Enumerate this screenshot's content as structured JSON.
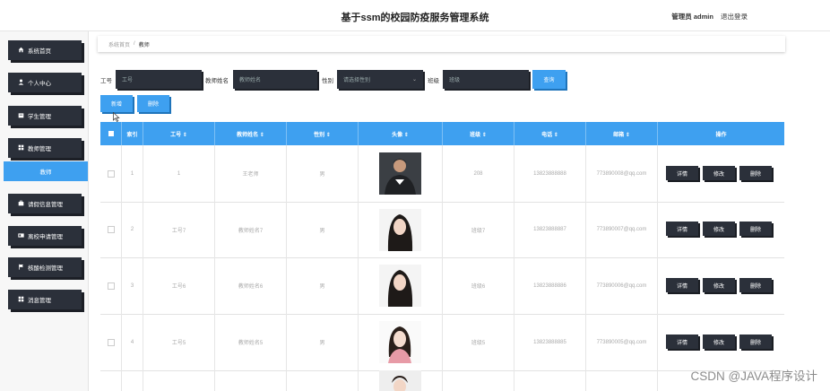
{
  "header": {
    "title": "基于ssm的校园防疫服务管理系统",
    "user_label": "管理员 admin",
    "logout": "退出登录"
  },
  "sidebar": {
    "items": [
      {
        "label": "系统首页",
        "icon": "home-icon"
      },
      {
        "label": "个人中心",
        "icon": "user-icon"
      },
      {
        "label": "学生管理",
        "icon": "folder-icon"
      },
      {
        "label": "教师管理",
        "icon": "grid-icon"
      },
      {
        "label": "教师",
        "icon": "",
        "sub": true
      },
      {
        "label": "请假信息管理",
        "icon": "briefcase-icon"
      },
      {
        "label": "离校申请管理",
        "icon": "card-icon"
      },
      {
        "label": "核酸检测管理",
        "icon": "flag-icon"
      },
      {
        "label": "消息管理",
        "icon": "grid-icon"
      }
    ]
  },
  "breadcrumb": {
    "home": "系统首页",
    "sep": "/",
    "current": "教师"
  },
  "search": {
    "id_label": "工号",
    "id_placeholder": "工号",
    "name_label": "教师姓名",
    "name_placeholder": "教师姓名",
    "gender_label": "性别",
    "gender_placeholder": "请选择性别",
    "class_label": "班级",
    "class_placeholder": "班级",
    "query_button": "查询"
  },
  "toolbar": {
    "add": "新增",
    "delete": "删除"
  },
  "table": {
    "headers": [
      "索引",
      "工号 ⇕",
      "教师姓名 ⇕",
      "性别 ⇕",
      "头像 ⇕",
      "班级 ⇕",
      "电话 ⇕",
      "邮箱 ⇕",
      "操作"
    ],
    "rows": [
      {
        "index": "1",
        "id": "1",
        "name": "王老师",
        "gender": "男",
        "class": "208",
        "phone": "13823888888",
        "email": "773890008@qq.com"
      },
      {
        "index": "2",
        "id": "工号7",
        "name": "教师姓名7",
        "gender": "男",
        "class": "班级7",
        "phone": "13823888887",
        "email": "773890007@qq.com"
      },
      {
        "index": "3",
        "id": "工号6",
        "name": "教师姓名6",
        "gender": "男",
        "class": "班级6",
        "phone": "13823888886",
        "email": "773890006@qq.com"
      },
      {
        "index": "4",
        "id": "工号5",
        "name": "教师姓名5",
        "gender": "男",
        "class": "班级5",
        "phone": "13823888885",
        "email": "773890005@qq.com"
      }
    ],
    "actions": {
      "detail": "详情",
      "edit": "修改",
      "delete": "删除"
    }
  },
  "watermark": "CSDN @JAVA程序设计",
  "colors": {
    "accent": "#3ea0f0",
    "dark": "#2b303a"
  }
}
